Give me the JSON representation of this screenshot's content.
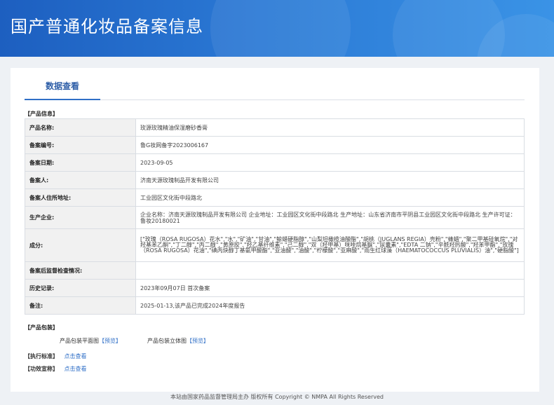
{
  "header": {
    "title": "国产普通化妆品备案信息"
  },
  "tabs": [
    {
      "label": "数据查看"
    }
  ],
  "product_section": {
    "heading": "【产品信息】",
    "rows": [
      {
        "label": "产品名称:",
        "value": "玫源玫瑰精油保湿磨砂香膏"
      },
      {
        "label": "备案编号:",
        "value": "鲁G妆网备字2023006167"
      },
      {
        "label": "备案日期:",
        "value": "2023-09-05"
      },
      {
        "label": "备案人:",
        "value": "济南天源玫瑰制品开发有限公司"
      },
      {
        "label": "备案人住所地址:",
        "value": "工业园区文化街中段路北"
      },
      {
        "label": "生产企业:",
        "value": "企业名称：济南天源玫瑰制品开发有限公司 企业地址：工业园区文化街中段路北 生产地址：山东省济南市平阴县工业园区文化街中段路北 生产许可证：鲁妆20180021"
      },
      {
        "label": "成分:",
        "value": "[\"玫瑰（ROSA RUGOSA）花水\",\"水\",\"矿油\",\"甘油\",\"鲸蜡硬脂醇\",\"山梨坦橄榄油酸酯\",\"胡桃（JUGLANS REGIA）壳粉\",\"蜂蜡\",\"聚二甲基硅氧烷\",\"对羟基苯乙酮\",\"丁二醇\",\"丙二醇\",\"黄原胶\",\"羟乙基纤维素\",\"己二醇\",\"双（羟甲基）咪唑烷基脲\",\"尿囊素\",\"EDTA 二钠\",\"辛酰羟肟酸\",\"羟苯甲酯\",\"玫瑰（ROSA RUGOSA）花油\",\"碘丙炔醇丁基氨甲酸酯\",\"亚油酸\",\"油酸\",\"柠檬酸\",\"亚麻酸\",\"雨生红球藻（HAEMATOCOCCUS PLUVIALIS）油\",\"硬脂酸\"]"
      },
      {
        "label": "备案后监督检查情况:",
        "value": ""
      },
      {
        "label": "历史记录:",
        "value": "2023年09月07日 首次备案"
      },
      {
        "label": "备注:",
        "value": "2025-01-13,该产品已完成2024年度报告"
      }
    ]
  },
  "packaging": {
    "heading": "【产品包装】",
    "flat_label": "产品包装平面图",
    "flat_link": "【预览】",
    "solid_label": "产品包装立体图",
    "solid_link": "【预览】"
  },
  "standard": {
    "heading": "【执行标准】",
    "link": "点击查看"
  },
  "efficacy": {
    "heading": "【功效宣称】",
    "link": "点击查看"
  },
  "footer": {
    "text": "本站由国家药品监督管理局主办 版权所有 Copyright © NMPA All Rights Reserved"
  }
}
